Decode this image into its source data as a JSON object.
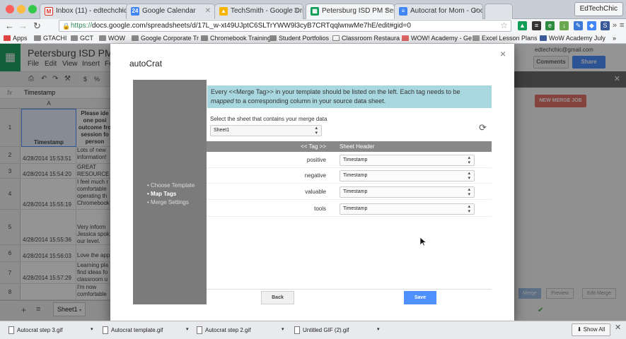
{
  "browser": {
    "tabs": [
      {
        "label": "Inbox (11) - edtechchic@",
        "icon": "gmail-icon"
      },
      {
        "label": "Google Calendar",
        "icon": "calendar-icon"
      },
      {
        "label": "TechSmith - Google Drive",
        "icon": "drive-icon"
      },
      {
        "label": "Petersburg ISD PM Sessio",
        "icon": "sheets-icon"
      },
      {
        "label": "Autocrat for Mom - Googl",
        "icon": "docs-icon"
      }
    ],
    "profile_name": "EdTechChic",
    "url_scheme": "https://",
    "url_rest": "docs.google.com/spreadsheets/d/17L_w-xt49UJptC6SLTrYWW9l3cyB7CRTqqlwnwMe7hE/edit#gid=0",
    "bookmarks": [
      "Apps",
      "GTACHI",
      "GCT",
      "WOW",
      "Google Corporate Tr",
      "Chromebook Training",
      "Student Portfolios",
      "Classroom Restaura",
      "WOW! Academy - Ge",
      "Excel Lesson Plans",
      "WoW Academy July"
    ],
    "bookmarks_more": "»"
  },
  "sheets": {
    "doc_title": "Petersburg ISD PM Se",
    "menus": [
      "File",
      "Edit",
      "View",
      "Insert",
      "Fo"
    ],
    "fx_label": "fx",
    "fx_value": "Timestamp",
    "column_a": "A",
    "header_a": "Timestamp",
    "header_b": "Please ide one posi outcome fro session fo person",
    "rows": [
      {
        "num": "1",
        "a": "",
        "b": ""
      },
      {
        "num": "2",
        "a": "4/28/2014 15:53:51",
        "b": "Lots of new information!"
      },
      {
        "num": "3",
        "a": "4/28/2014 15:54:20",
        "b": "GREAT RESOURCE"
      },
      {
        "num": "4",
        "a": "4/28/2014 15:55:19",
        "b": "I feel much r comfortable operating th Chromebook"
      },
      {
        "num": "5",
        "a": "4/28/2014 15:55:36",
        "b": "Very inform Jessica spok our level."
      },
      {
        "num": "6",
        "a": "4/28/2014 15:56:03",
        "b": "Love the app"
      },
      {
        "num": "7",
        "a": "4/28/2014 15:57:29",
        "b": "Learning pla find ideas fo classroom u"
      },
      {
        "num": "8",
        "a": "",
        "b": "I'm now comfortable"
      }
    ],
    "sheet_tab": "Sheet1",
    "user_email": "edtechchic@gmail.com",
    "comments_label": "Comments",
    "share_label": "Share",
    "side_new_merge": "NEW MERGE JOB",
    "side_bottom": [
      "Merge",
      "Preview",
      "Edit Merge"
    ]
  },
  "modal": {
    "title": "autoCrat",
    "close": "×",
    "nav": [
      "Choose Template",
      "Map Tags",
      "Merge Settings"
    ],
    "nav_active_index": 1,
    "info_part1": "Every <<Merge Tag>> in your template should be listed on the left. Each tag needs to be",
    "info_italic": "mapped",
    "info_part2": "to a corresponding column in your source data sheet.",
    "select_sheet_label": "Select the sheet that contains your merge data",
    "sheet_value": "Sheet1",
    "tag_header": "<< Tag >>",
    "sheet_header": "Sheet Header",
    "mappings": [
      {
        "tag": "positive",
        "value": "Timestamp"
      },
      {
        "tag": "negative",
        "value": "Timestamp"
      },
      {
        "tag": "valuable",
        "value": "Timestamp"
      },
      {
        "tag": "tools",
        "value": "Timestamp"
      }
    ],
    "back_label": "Back",
    "save_label": "Save"
  },
  "downloads": {
    "items": [
      "Autocrat step 3.gif",
      "Autocrat template.gif",
      "Autocrat step 2.gif",
      "Untitled GIF (2).gif"
    ],
    "show_all": "Show All"
  }
}
